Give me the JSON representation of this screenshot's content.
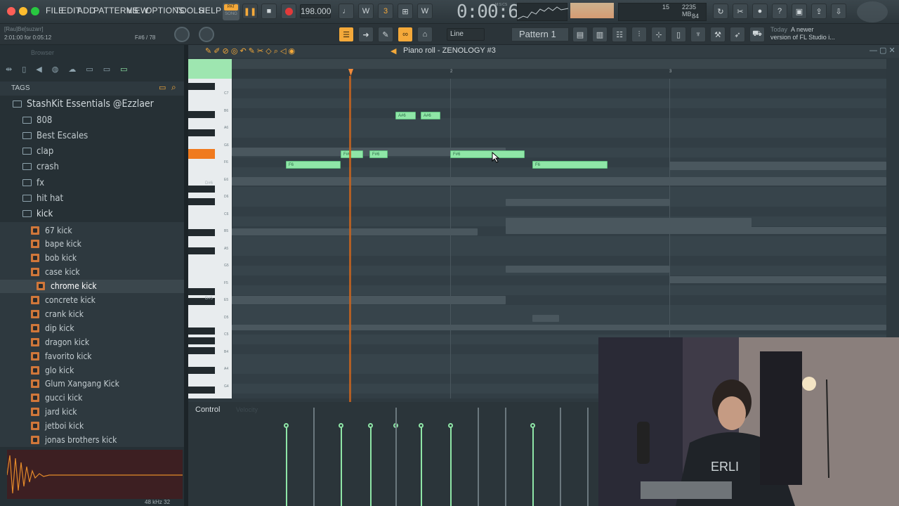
{
  "menu": [
    "FILE",
    "EDIT",
    "ADD",
    "PATTERNS",
    "VIEW",
    "OPTIONS",
    "TOOLS",
    "HELP"
  ],
  "transport": {
    "pat_label": "PAT",
    "song_label": "SONG",
    "tempo": "198.000",
    "time": "0:00:67",
    "time_unit": "M:S:CS",
    "memory": "2235 MB",
    "cpu": "15",
    "voices": "84"
  },
  "hint": {
    "line1": "[Rau]Be[suzarr]",
    "line2": "2:01:00 for 0:05:12",
    "key": "F#6 / 78"
  },
  "toolbar2": {
    "snap_mode": "Line",
    "pattern": "Pattern 1",
    "news_date": "Today",
    "news_text": "A newer",
    "news_text2": "version of FL Studio i..."
  },
  "browser": {
    "title": "Browser",
    "tags_label": "TAGS",
    "root": "StashKit Essentials @Ezzlaer",
    "folders": [
      "808",
      "Best Escales",
      "clap",
      "crash",
      "fx",
      "hit hat",
      "kick"
    ],
    "kicks": [
      "67 kick",
      "bape kick",
      "bob kick",
      "case kick",
      "chrome kick",
      "concrete kick",
      "crank kick",
      "dip kick",
      "dragon kick",
      "favorito kick",
      "glo kick",
      "Glum Xangang Kick",
      "gucci kick",
      "jard kick",
      "jetboi kick",
      "jonas brothers kick"
    ],
    "selected": "chrome kick",
    "sample_info": "48 kHz 32"
  },
  "pianoroll": {
    "title": "Piano roll - ZENOLOGY #3",
    "bar2": "2",
    "bar3": "3",
    "control_label": "Control",
    "control_sub": "Velocity",
    "key_labels": [
      "C7",
      "B6",
      "A6",
      "G6",
      "F6",
      "E6",
      "D6",
      "C6",
      "B5",
      "A5",
      "G5",
      "F5",
      "E5",
      "D5",
      "C5",
      "B4",
      "A4",
      "G4"
    ],
    "d6_label": "D#6",
    "d5_label": "D#5",
    "notes": [
      {
        "label": "A#6"
      },
      {
        "label": "A#6"
      },
      {
        "label": "F#6"
      },
      {
        "label": "F#6"
      },
      {
        "label": "F#6"
      },
      {
        "label": "F6"
      },
      {
        "label": "F6"
      }
    ]
  }
}
